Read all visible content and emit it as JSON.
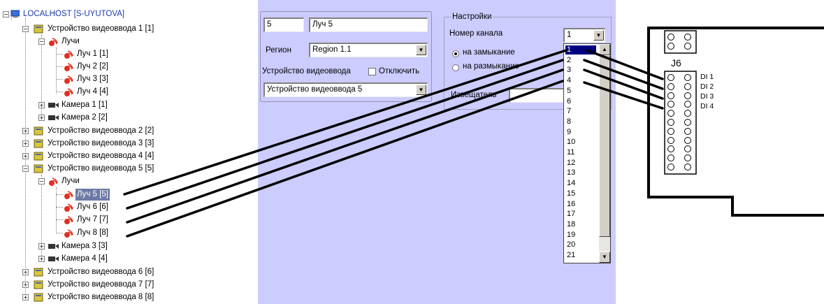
{
  "tree": {
    "root": "LOCALHOST [S-UYUTOVA]",
    "nodes": [
      "Устройство видеоввода 1 [1]",
      "Лучи",
      "Луч 1 [1]",
      "Луч 2 [2]",
      "Луч 3 [3]",
      "Луч 4 [4]",
      "Камера 1 [1]",
      "Камера 2 [2]",
      "Устройство видеоввода 2 [2]",
      "Устройство видеоввода 3 [3]",
      "Устройство видеоввода 4 [4]",
      "Устройство видеоввода 5 [5]",
      "Лучи",
      "Луч 5 [5]",
      "Луч 6 [6]",
      "Луч 7 [7]",
      "Луч 8 [8]",
      "Камера 3 [3]",
      "Камера 4 [4]",
      "Устройство видеоввода 6 [6]",
      "Устройство видеоввода 7 [7]",
      "Устройство видеоввода 8 [8]"
    ]
  },
  "panel": {
    "id_value": "5",
    "name_value": "Луч 5",
    "region_label": "Регион",
    "region_value": "Region 1.1",
    "device_label": "Устройство видеоввода",
    "disable_label": "Отключить",
    "device_value": "Устройство видеоввода 5",
    "settings_title": "Настройки",
    "channel_label": "Номер канала",
    "channel_value": "1",
    "radio_close": "на замыкание",
    "radio_open": "на размыкание",
    "detector_label": "Извещатель",
    "channel_options": [
      "1",
      "2",
      "3",
      "4",
      "5",
      "6",
      "7",
      "8",
      "9",
      "10",
      "11",
      "12",
      "13",
      "14",
      "15",
      "16",
      "17",
      "18",
      "19",
      "20",
      "21"
    ]
  },
  "board": {
    "connector": "J6",
    "inputs": [
      "DI 1",
      "DI 2",
      "DI 3",
      "DI 4"
    ]
  },
  "colors": {
    "selection": "#6d7aa6",
    "panel": "#ccccff",
    "list_active": "#000080"
  }
}
